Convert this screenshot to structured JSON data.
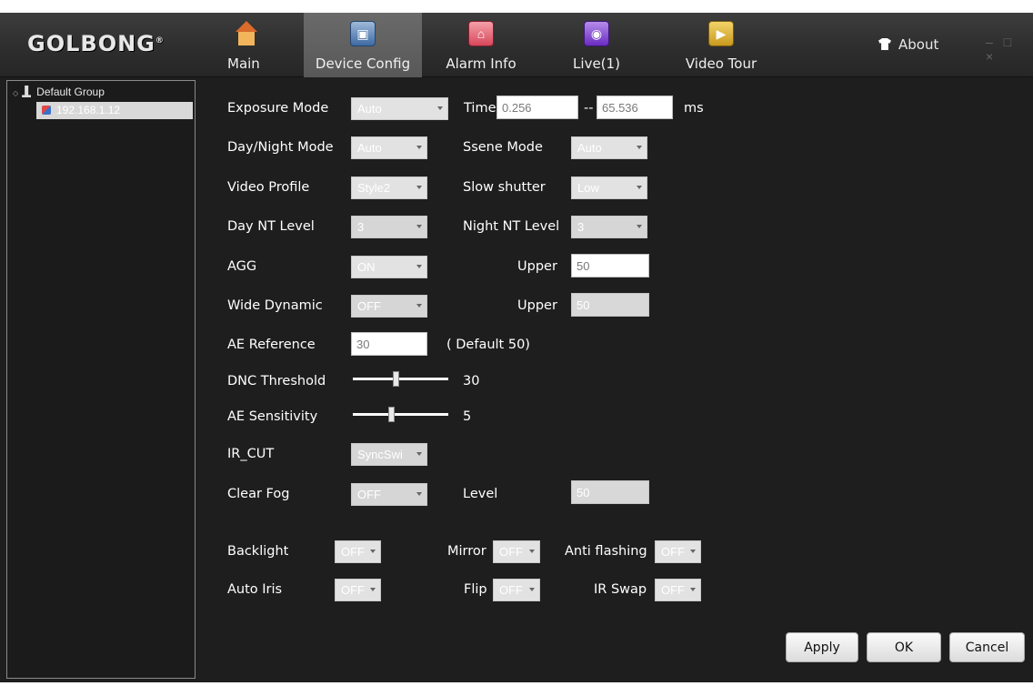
{
  "app": {
    "logo": "GOLBONG",
    "logo_mark": "®",
    "about_label": "About",
    "window_controls": "– □ ×"
  },
  "nav": {
    "tabs": [
      {
        "label": "Main",
        "icon": "house-icon",
        "active": false
      },
      {
        "label": "Device Config",
        "icon": "device-config-icon",
        "active": true
      },
      {
        "label": "Alarm Info",
        "icon": "alarm-icon",
        "active": false
      },
      {
        "label": "Live(1)",
        "icon": "live-icon",
        "active": false
      },
      {
        "label": "Video Tour",
        "icon": "video-tour-icon",
        "active": false
      }
    ]
  },
  "tree": {
    "group_label": "Default Group",
    "device_label": "192.168.1.12"
  },
  "form": {
    "exposure_mode": {
      "label": "Exposure Mode",
      "value": "Auto"
    },
    "time": {
      "label": "Time",
      "min": "0.256",
      "sep": "--",
      "max": "65.536",
      "unit": "ms"
    },
    "day_night_mode": {
      "label": "Day/Night Mode",
      "value": "Auto"
    },
    "scene_mode": {
      "label": "Ssene Mode",
      "value": "Auto"
    },
    "video_profile": {
      "label": "Video Profile",
      "value": "Style2"
    },
    "slow_shutter": {
      "label": "Slow shutter",
      "value": "Low"
    },
    "day_nt_level": {
      "label": "Day NT Level",
      "value": "3"
    },
    "night_nt_level": {
      "label": "Night NT Level",
      "value": "3"
    },
    "agg": {
      "label": "AGG",
      "value": "ON",
      "upper_label": "Upper",
      "upper_value": "50"
    },
    "wide_dynamic": {
      "label": "Wide Dynamic",
      "value": "OFF",
      "upper_label": "Upper",
      "upper_value": "50"
    },
    "ae_reference": {
      "label": "AE Reference",
      "value": "30",
      "hint": "( Default 50)"
    },
    "dnc_threshold": {
      "label": "DNC Threshold",
      "value": "30"
    },
    "ae_sensitivity": {
      "label": "AE Sensitivity",
      "value": "5"
    },
    "ir_cut": {
      "label": "IR_CUT",
      "value": "SyncSwi"
    },
    "clear_fog": {
      "label": "Clear Fog",
      "value": "OFF",
      "level_label": "Level",
      "level_value": "50"
    },
    "backlight": {
      "label": "Backlight",
      "value": "OFF"
    },
    "auto_iris": {
      "label": "Auto Iris",
      "value": "OFF"
    },
    "mirror": {
      "label": "Mirror",
      "value": "OFF"
    },
    "flip": {
      "label": "Flip",
      "value": "OFF"
    },
    "anti_flashing": {
      "label": "Anti flashing",
      "value": "OFF"
    },
    "ir_swap": {
      "label": "IR Swap",
      "value": "OFF"
    }
  },
  "sliders": {
    "dnc_threshold_fraction": 0.45,
    "ae_sensitivity_fraction": 0.4
  },
  "buttons": {
    "apply": "Apply",
    "ok": "OK",
    "cancel": "Cancel"
  }
}
